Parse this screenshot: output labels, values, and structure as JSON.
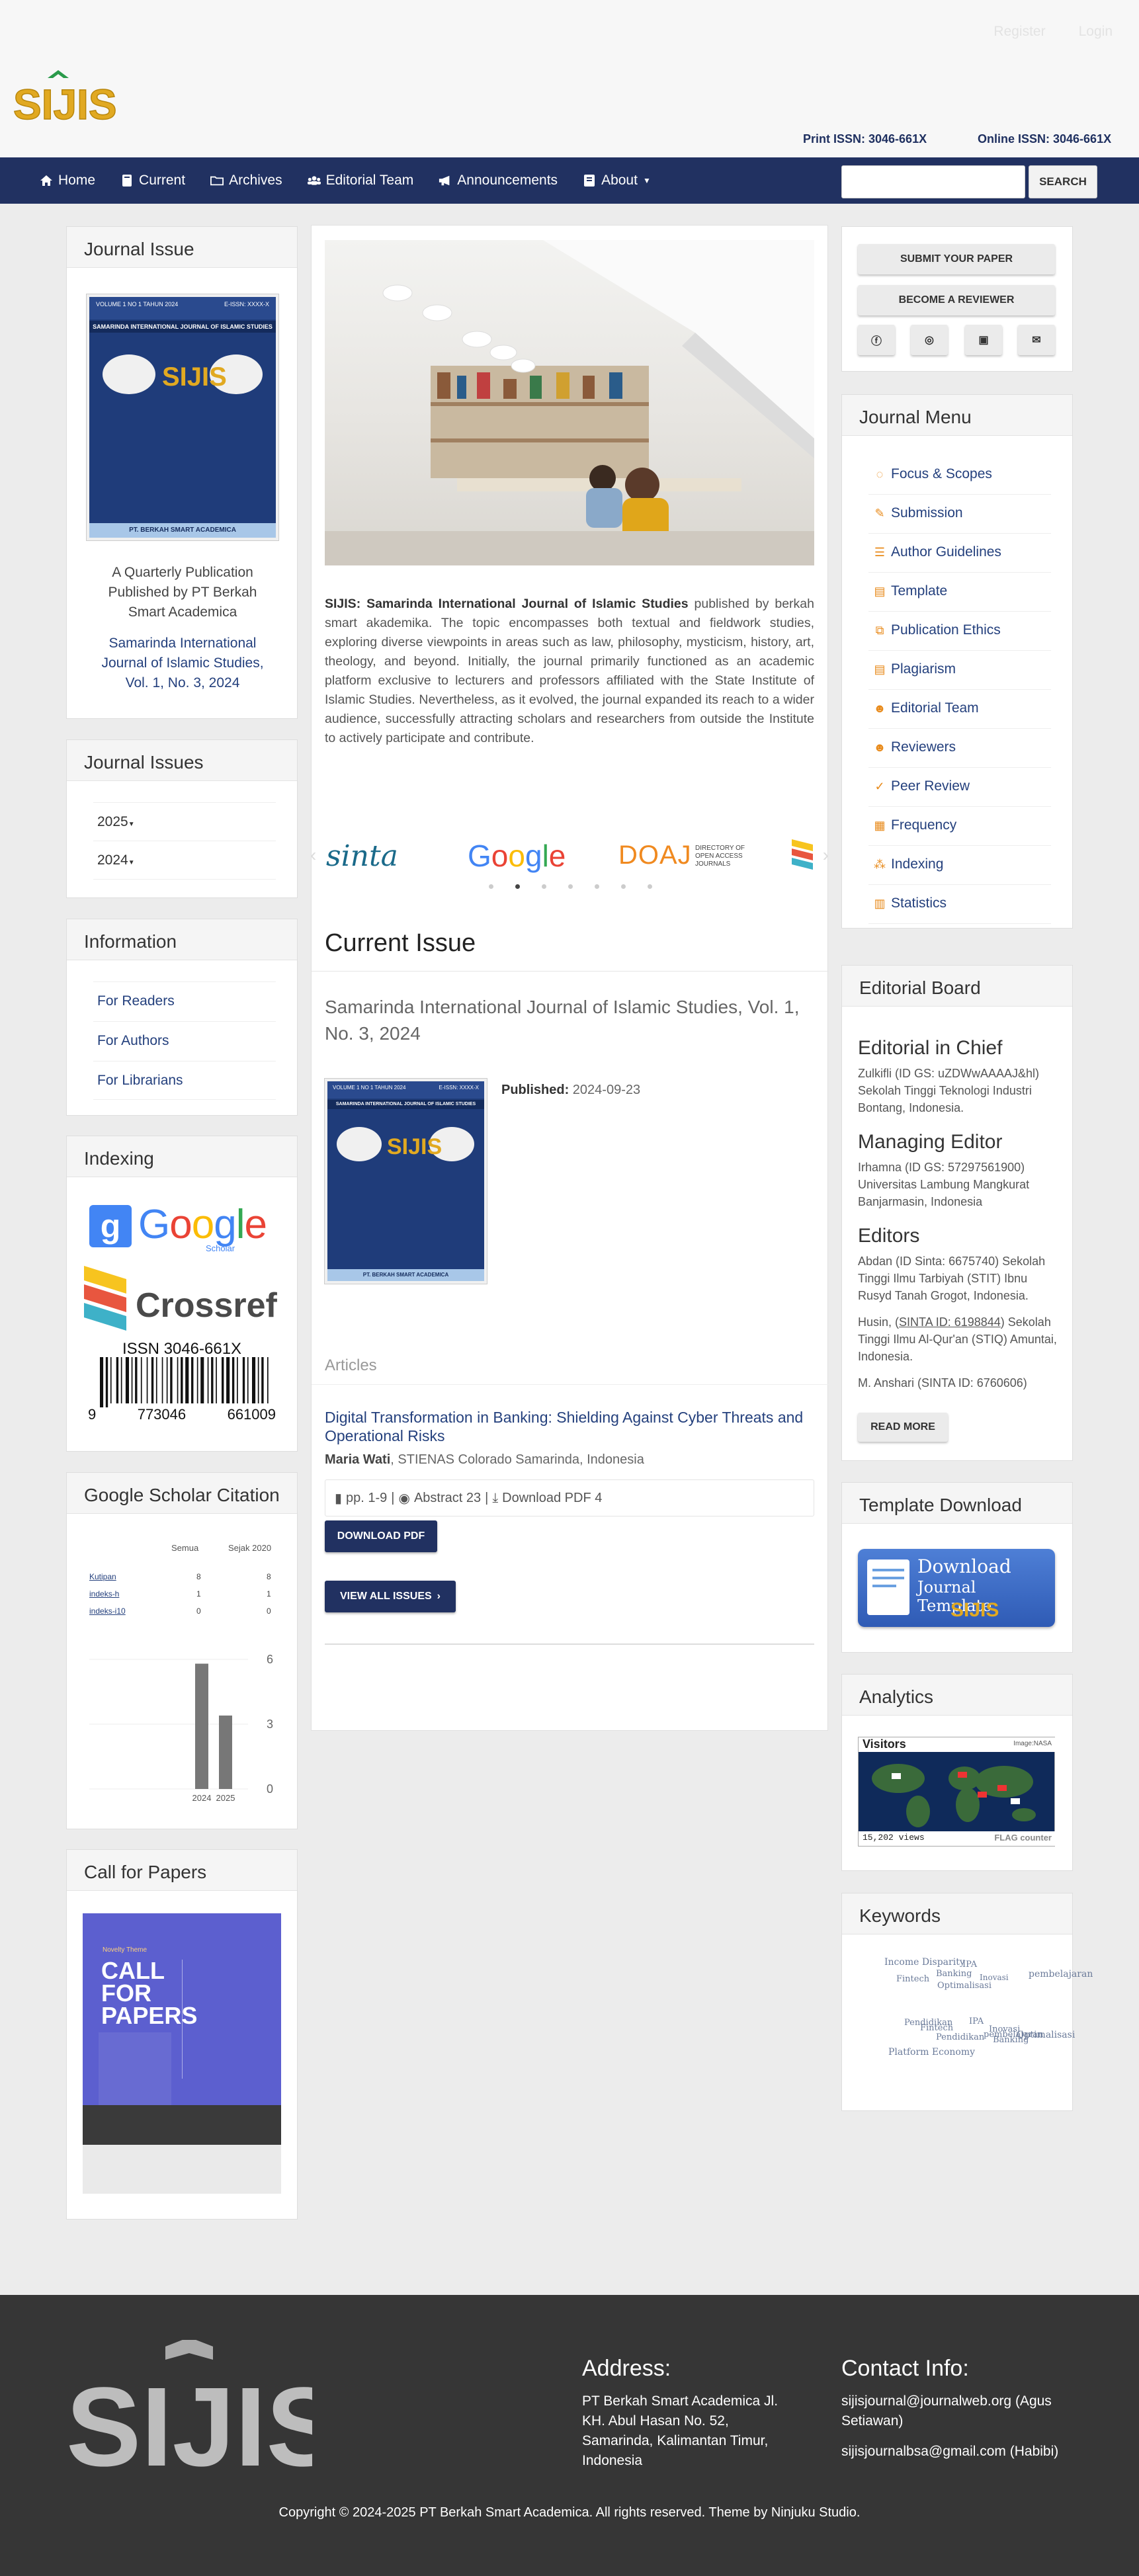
{
  "header": {
    "register": "Register",
    "login": "Login",
    "print_issn": "Print ISSN: 3046-661X",
    "online_issn": "Online ISSN: 3046-661X",
    "logo_text": "SIJIS"
  },
  "nav": {
    "items": [
      {
        "label": "Home",
        "icon": "home-icon"
      },
      {
        "label": "Current",
        "icon": "book-icon"
      },
      {
        "label": "Archives",
        "icon": "folder-icon"
      },
      {
        "label": "Editorial Team",
        "icon": "users-icon"
      },
      {
        "label": "Announcements",
        "icon": "bullhorn-icon"
      },
      {
        "label": "About",
        "icon": "info-icon"
      }
    ],
    "search_button": "SEARCH",
    "search_value": ""
  },
  "journal_issue": {
    "title": "Journal Issue",
    "cover_top": "VOLUME 1 NO 1 TAHUN 2024",
    "cover_issn": "E-ISSN: XXXX-X",
    "cover_title": "SAMARINDA INTERNATIONAL JOURNAL OF ISLAMIC STUDIES",
    "cover_publisher": "PT. BERKAH SMART ACADEMICA",
    "desc": "A Quarterly Publication Published by PT Berkah Smart Academica",
    "issue_link": "Samarinda International Journal of Islamic Studies, Vol. 1, No. 3, 2024"
  },
  "journal_issues": {
    "title": "Journal Issues",
    "years": [
      "2025",
      "2024"
    ]
  },
  "information": {
    "title": "Information",
    "links": [
      "For Readers",
      "For Authors",
      "For Librarians"
    ]
  },
  "indexing": {
    "title": "Indexing",
    "google": "Google",
    "google_sub": "Scholar",
    "crossref": "Crossref",
    "issn": "ISSN 3046-661X",
    "barcode_digits": [
      "9",
      "773046",
      "661009"
    ]
  },
  "gsc": {
    "title": "Google Scholar Citation",
    "col1": "Semua",
    "col2": "Sejak 2020",
    "rows": [
      {
        "label": "Kutipan",
        "all": "8",
        "since": "8"
      },
      {
        "label": "indeks-h",
        "all": "1",
        "since": "1"
      },
      {
        "label": "indeks-i10",
        "all": "0",
        "since": "0"
      }
    ],
    "chart_data": {
      "type": "bar",
      "categories": [
        "2024",
        "2025"
      ],
      "values": [
        5.8,
        3.4
      ],
      "ylim": [
        0,
        6
      ],
      "yticks": [
        "6",
        "3",
        "0"
      ]
    }
  },
  "call_for_papers": {
    "title": "Call for Papers",
    "poster_title": "CALL FOR PAPERS",
    "poster_theme": "Novelty Theme"
  },
  "main": {
    "journal_name": "SIJIS: Samarinda International Journal of Islamic Studies",
    "about": " published by berkah smart akademika. The topic encompasses both textual and fieldwork studies, exploring diverse viewpoints in areas such as law, philosophy, mysticism, history, art, theology, and beyond. Initially, the journal primarily functioned as an academic platform exclusive to lecturers and professors affiliated with the State Institute of Islamic Studies. Nevertheless, as it evolved, the journal expanded its reach to a wider audience, successfully attracting scholars and researchers from outside the Institute to actively participate and contribute.",
    "carousel": [
      "sinta",
      "Google",
      "DOAJ"
    ],
    "doaj_sub": "DIRECTORY OF OPEN ACCESS JOURNALS",
    "current_issue": "Current Issue",
    "issue_title": "Samarinda International Journal of Islamic Studies, Vol. 1, No. 3, 2024",
    "published_label": "Published:",
    "published_date": "2024-09-23",
    "articles": "Articles",
    "article_title": "Digital Transformation in Banking: Shielding Against Cyber Threats and Operational Risks",
    "author": "Maria Wati",
    "affiliation": ", STIENAS Colorado Samarinda, Indonesia",
    "pages": "pp. 1-9",
    "abstract": "Abstract 23",
    "download": "Download PDF 4",
    "download_btn": "DOWNLOAD PDF",
    "view_all": "VIEW ALL ISSUES"
  },
  "right": {
    "submit": "SUBMIT YOUR PAPER",
    "reviewer": "BECOME A REVIEWER",
    "social": [
      "facebook-icon",
      "whatsapp-icon",
      "instagram-icon",
      "mail-icon"
    ]
  },
  "journal_menu": {
    "title": "Journal Menu",
    "items": [
      "Focus & Scopes",
      "Submission",
      "Author Guidelines",
      "Template",
      "Publication Ethics",
      "Plagiarism",
      "Editorial Team",
      "Reviewers",
      "Peer Review",
      "Frequency",
      "Indexing",
      "Statistics"
    ]
  },
  "editorial": {
    "title": "Editorial Board",
    "chief_h": "Editorial in Chief",
    "chief": "Zulkifli (ID GS: uZDWwAAAAJ&hl) Sekolah Tinggi Teknologi Industri Bontang, Indonesia.",
    "managing_h": "Managing Editor",
    "managing": "Irhamna (ID GS: 57297561900) Universitas Lambung Mangkurat Banjarmasin, Indonesia",
    "editors_h": "Editors",
    "e1": "Abdan (ID Sinta: 6675740) Sekolah Tinggi Ilmu Tarbiyah (STIT) Ibnu Rusyd Tanah Grogot, Indonesia.",
    "e2_a": "Husin, (",
    "e2_link": "SINTA ID: 6198844",
    "e2_b": ") Sekolah Tinggi Ilmu Al-Qur'an (STIQ) Amuntai, Indonesia.",
    "e3": "M. Anshari (SINTA ID: 6760606)",
    "read_more": "READ MORE"
  },
  "template": {
    "title": "Template Download",
    "line1": "Download",
    "line2": "Journal Template"
  },
  "analytics": {
    "title": "Analytics",
    "visitors": "Visitors",
    "nasa": "Image:NASA",
    "views": "15,202 views",
    "flag": "FLAG counter"
  },
  "keywords": {
    "title": "Keywords",
    "words": [
      "Income Disparity",
      "IPA",
      "Banking",
      "Fintech",
      "Inovasi",
      "pembelajaran",
      "Optimalisasi",
      "Pendidikan",
      "Fintech",
      "IPA",
      "Inovasi",
      "Pendidikan",
      "pembelajaran",
      "Optimalisasi",
      "Banking",
      "Platform Economy"
    ]
  },
  "footer": {
    "address_h": "Address:",
    "address": "PT Berkah Smart Academica Jl. KH. Abul Hasan No. 52, Samarinda, Kalimantan Timur, Indonesia",
    "contact_h": "Contact Info:",
    "contact1": "sijisjournal@journalweb.org (Agus Setiawan)",
    "contact2": "sijisjournalbsa@gmail.com (Habibi)",
    "copyright": "Copyright © 2024-2025 PT Berkah Smart Academica. All rights reserved. Theme by Ninjuku Studio."
  },
  "colors": {
    "nav": "#213161",
    "link": "#24407d",
    "accent": "#e88a1a",
    "footer": "#363636"
  }
}
